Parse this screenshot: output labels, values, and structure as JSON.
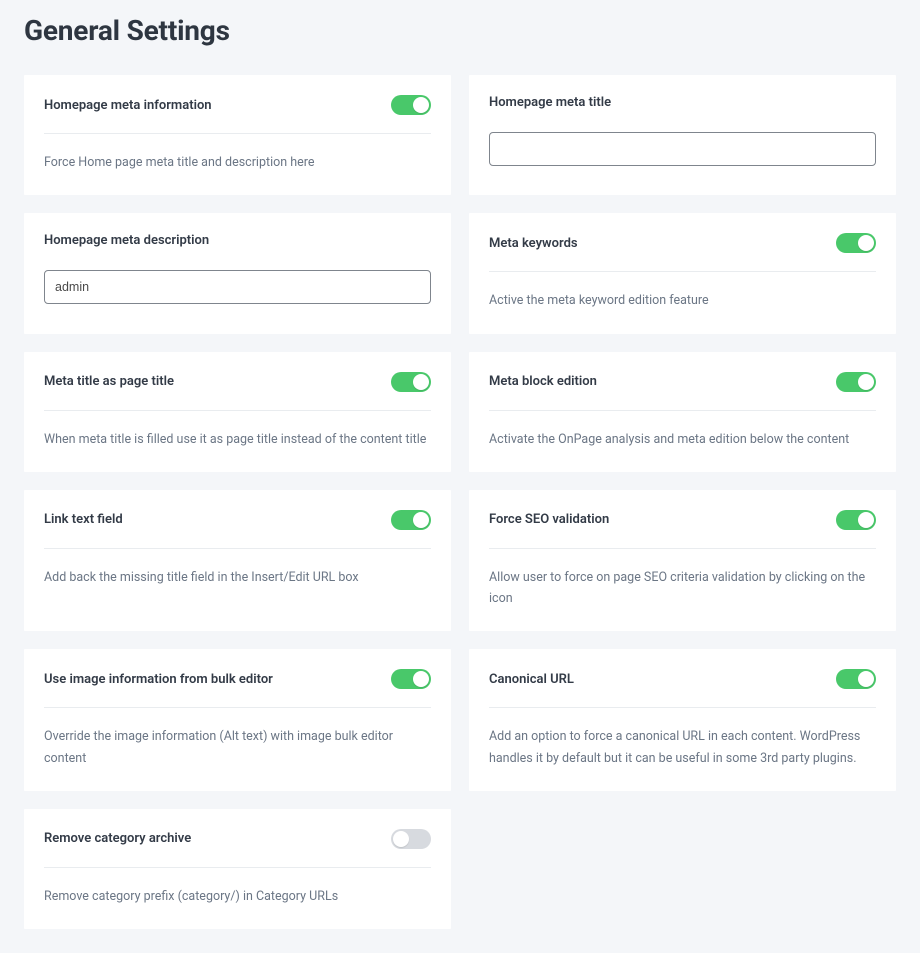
{
  "page": {
    "title": "General Settings"
  },
  "cards": {
    "home_meta_info": {
      "title": "Homepage meta information",
      "desc": "Force Home page meta title and description here"
    },
    "home_meta_title": {
      "title": "Homepage meta title",
      "value": ""
    },
    "home_meta_desc": {
      "title": "Homepage meta description",
      "value": "admin"
    },
    "meta_keywords": {
      "title": "Meta keywords",
      "desc": "Active the meta keyword edition feature"
    },
    "meta_title_as_page": {
      "title": "Meta title as page title",
      "desc": "When meta title is filled use it as page title instead of the content title"
    },
    "meta_block": {
      "title": "Meta block edition",
      "desc": "Activate the OnPage analysis and meta edition below the content"
    },
    "link_text_field": {
      "title": "Link text field",
      "desc": "Add back the missing title field in the Insert/Edit URL box"
    },
    "force_seo": {
      "title": "Force SEO validation",
      "desc": "Allow user to force on page SEO criteria validation by clicking on the icon"
    },
    "use_image_info": {
      "title": "Use image information from bulk editor",
      "desc": "Override the image information (Alt text) with image bulk editor content"
    },
    "canonical_url": {
      "title": "Canonical URL",
      "desc": "Add an option to force a canonical URL in each content. WordPress handles it by default but it can be useful in some 3rd party plugins."
    },
    "remove_cat_archive": {
      "title": "Remove category archive",
      "desc": "Remove category prefix (category/) in Category URLs"
    }
  },
  "toggles": {
    "home_meta_info": true,
    "meta_keywords": true,
    "meta_title_as_page": true,
    "meta_block": true,
    "link_text_field": true,
    "force_seo": true,
    "use_image_info": true,
    "canonical_url": true,
    "remove_cat_archive": false
  }
}
